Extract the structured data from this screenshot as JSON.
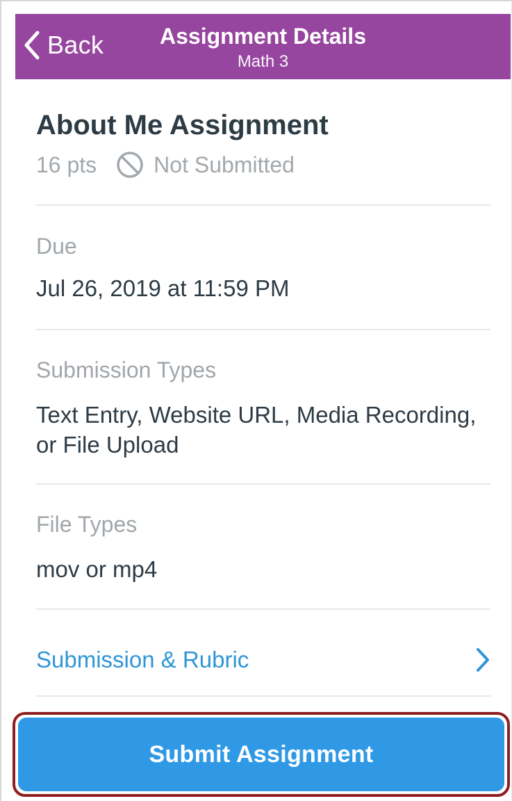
{
  "header": {
    "back_label": "Back",
    "title": "Assignment Details",
    "subtitle": "Math 3",
    "background_color": "#97469f"
  },
  "assignment": {
    "title": "About Me Assignment",
    "points": "16 pts",
    "status_icon": "not-submitted-icon",
    "status": "Not Submitted"
  },
  "sections": {
    "due": {
      "label": "Due",
      "value": "Jul 26, 2019 at 11:59 PM"
    },
    "submission_types": {
      "label": "Submission Types",
      "value": "Text Entry, Website URL, Media Recording, or File Upload"
    },
    "file_types": {
      "label": "File Types",
      "value": "mov or mp4"
    }
  },
  "links": {
    "submission_rubric": "Submission & Rubric",
    "link_color": "#2e96d8"
  },
  "actions": {
    "submit_label": "Submit Assignment",
    "button_color": "#2f99e6",
    "highlight_color": "#8f1d21"
  }
}
